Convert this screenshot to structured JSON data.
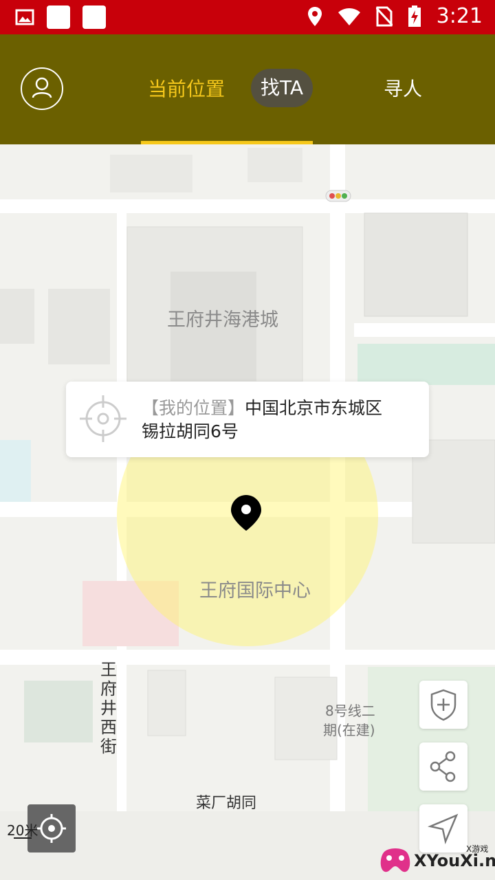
{
  "status_bar": {
    "time": "3:21"
  },
  "header": {
    "tabs": [
      {
        "label": "当前位置",
        "active": true
      },
      {
        "label": "找TA",
        "active": false
      },
      {
        "label": "寻人",
        "active": false
      }
    ]
  },
  "map": {
    "labels": {
      "wangfujing_haigang": "王府井海港城",
      "wangfu_intl": "王府国际中心",
      "wangfujing_west": "王府井西街",
      "metro_line8_1": "8号线二",
      "metro_line8_2": "期(在建)",
      "caichang": "菜厂胡同"
    },
    "scale": "20米"
  },
  "popup": {
    "bracket_label": "【我的位置】",
    "address_line1": "中国北京市东城区",
    "address_line2": "锡拉胡同6号"
  },
  "watermark": {
    "text": "XYouXi.net",
    "small": "X游戏"
  },
  "colors": {
    "header": "#6b6000",
    "status_bar": "#c8000a",
    "accent": "#f6c81b"
  }
}
